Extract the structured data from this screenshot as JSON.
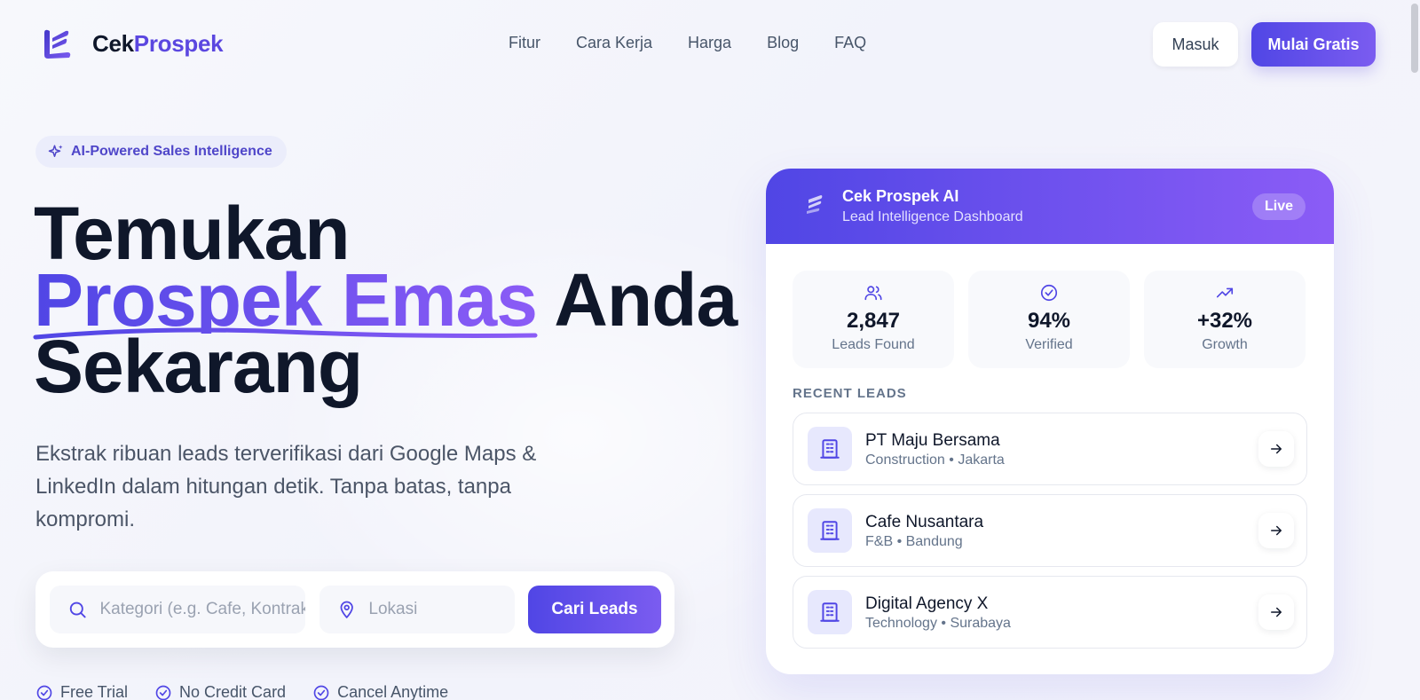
{
  "brand": {
    "name_part1": "Cek",
    "name_part2": "Prospek"
  },
  "nav": {
    "links": [
      "Fitur",
      "Cara Kerja",
      "Harga",
      "Blog",
      "FAQ"
    ],
    "login_label": "Masuk",
    "cta_label": "Mulai Gratis"
  },
  "hero": {
    "badge": "AI-Powered Sales Intelligence",
    "headline_line1": "Temukan",
    "headline_accent": "Prospek Emas",
    "headline_line2_rest": " Anda",
    "headline_line3": "Sekarang",
    "subtitle": "Ekstrak ribuan leads terverifikasi dari Google Maps & LinkedIn dalam hitungan detik. Tanpa batas, tanpa kompromi."
  },
  "search": {
    "category_placeholder": "Kategori (e.g. Cafe, Kontraktor)",
    "location_placeholder": "Lokasi",
    "button_label": "Cari Leads"
  },
  "checks": [
    "Free Trial",
    "No Credit Card",
    "Cancel Anytime"
  ],
  "dashboard": {
    "title": "Cek Prospek AI",
    "subtitle": "Lead Intelligence Dashboard",
    "status": "Live",
    "stats": [
      {
        "value": "2,847",
        "label": "Leads Found",
        "icon": "users-icon"
      },
      {
        "value": "94%",
        "label": "Verified",
        "icon": "check-circle-icon"
      },
      {
        "value": "+32%",
        "label": "Growth",
        "icon": "trending-up-icon"
      }
    ],
    "recent_title": "RECENT LEADS",
    "leads": [
      {
        "name": "PT Maju Bersama",
        "meta": "Construction • Jakarta"
      },
      {
        "name": "Cafe Nusantara",
        "meta": "F&B • Bandung"
      },
      {
        "name": "Digital Agency X",
        "meta": "Technology • Surabaya"
      }
    ]
  },
  "colors": {
    "accent": "#5046e5",
    "accent2": "#8b5cf6",
    "text": "#0f172a",
    "muted": "#64748b"
  }
}
